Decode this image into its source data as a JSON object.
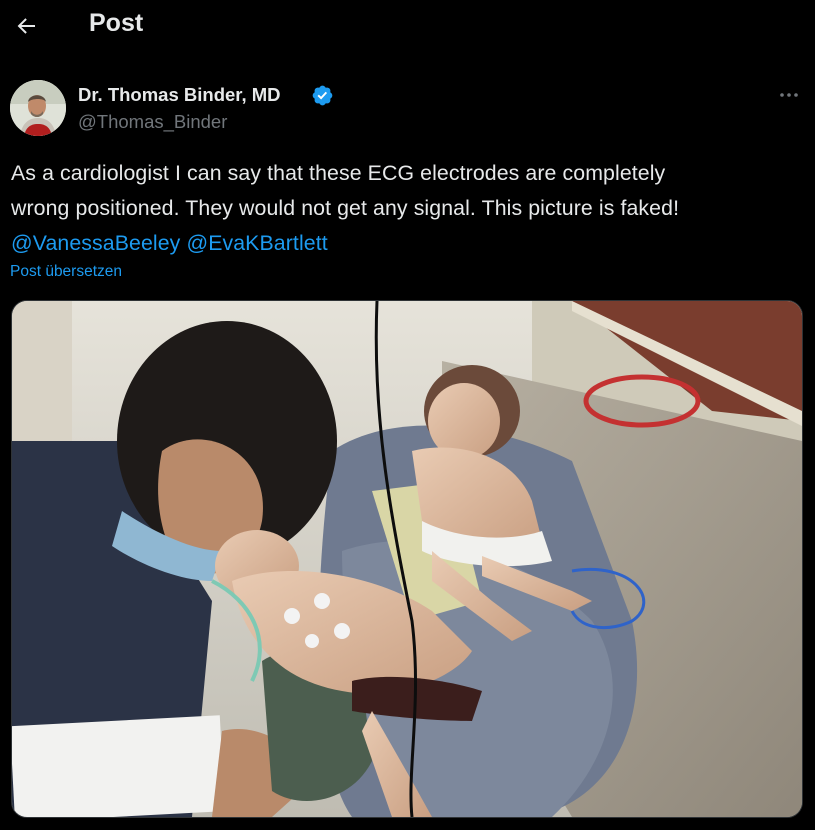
{
  "header": {
    "title": "Post"
  },
  "author": {
    "name": "Dr. Thomas Binder, MD",
    "handle": "@Thomas_Binder",
    "verified": true
  },
  "tweet": {
    "line1": "As a cardiologist I can say that these ECG electrodes are completely",
    "line2": "wrong positioned. They would not get any signal. This picture is faked!",
    "mentions": [
      "@VanessaBeeley",
      "@EvaKBartlett"
    ]
  },
  "translate_label": "Post übersetzen",
  "colors": {
    "background": "#000000",
    "text": "#e7e9ea",
    "secondary": "#71767b",
    "link": "#1d9bf0",
    "verified_badge": "#1d9bf0"
  },
  "icons": {
    "back": "arrow-left-icon",
    "verified": "verified-badge-icon",
    "more": "more-dots-icon"
  }
}
